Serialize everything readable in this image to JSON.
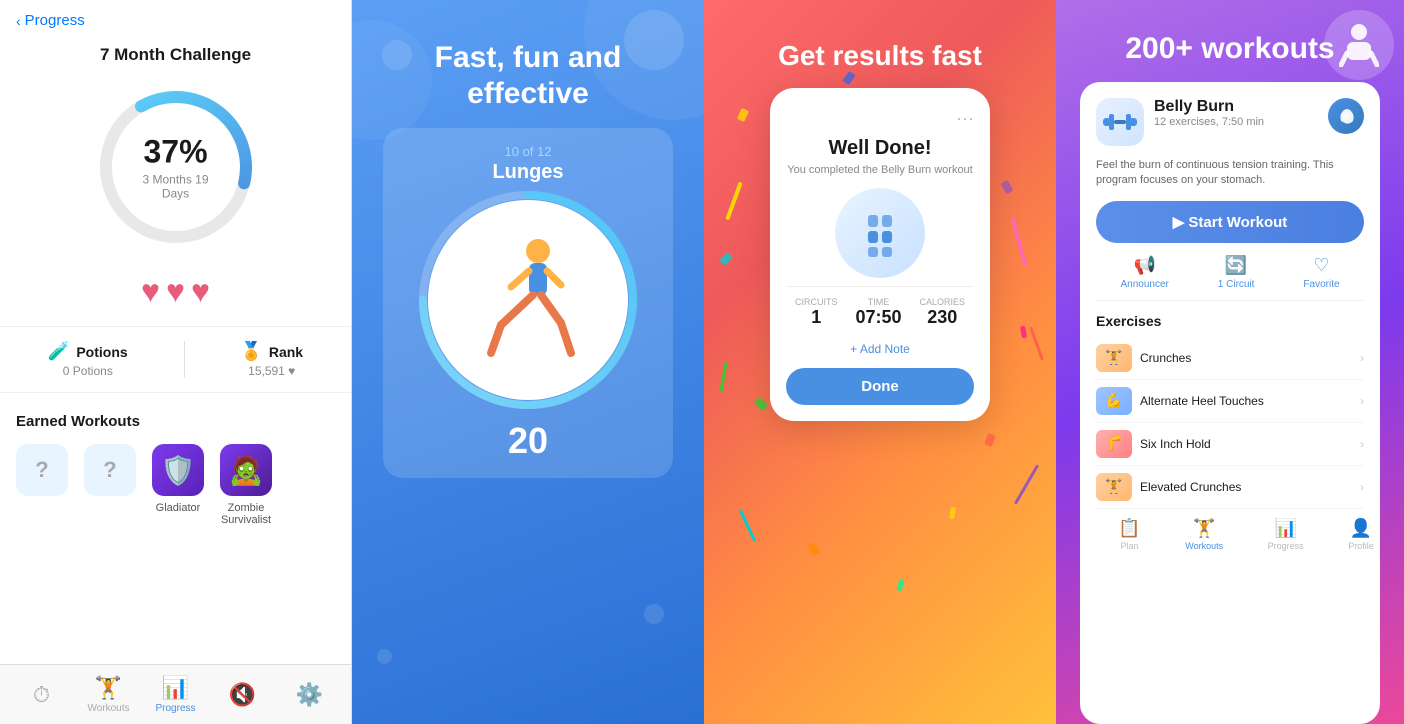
{
  "panel1": {
    "back_label": "Progress",
    "title": "7 Month Challenge",
    "percent": "37%",
    "days_remaining": "3 Months 19 Days",
    "hearts": [
      "❤️",
      "❤️",
      "❤️"
    ],
    "stats": {
      "potions_label": "Potions",
      "potions_value": "0 Potions",
      "rank_label": "Rank",
      "rank_value": "15,591 ♥"
    },
    "earned_title": "Earned Workouts",
    "earned_items": [
      {
        "label": "?",
        "name": "",
        "type": "question"
      },
      {
        "label": "?",
        "name": "",
        "type": "question"
      },
      {
        "label": "🛡️",
        "name": "Gladiator",
        "type": "gladiator"
      },
      {
        "label": "🧟",
        "name": "Zombie\nSurvivalist",
        "type": "zombie"
      }
    ],
    "nav": {
      "items": [
        {
          "icon": "⏱",
          "label": "",
          "active": false
        },
        {
          "icon": "🏋️",
          "label": "Workouts",
          "active": false
        },
        {
          "icon": "📊",
          "label": "Progress",
          "active": true
        },
        {
          "icon": "🔇",
          "label": "",
          "active": false
        },
        {
          "icon": "⚙️",
          "label": "",
          "active": false
        }
      ]
    }
  },
  "panel2": {
    "headline": "Fast, fun and\neffective",
    "exercise_counter": "10 of 12",
    "exercise_name": "Lunges",
    "rep_count": "20"
  },
  "panel3": {
    "headline": "Get results fast",
    "well_done": "Well Done!",
    "subtitle": "You completed the Belly Burn workout",
    "stats": {
      "circuits_label": "Circuits",
      "circuits_value": "1",
      "time_label": "Time",
      "time_value": "07:50",
      "calories_label": "Calories",
      "calories_value": "230"
    },
    "add_note": "+ Add Note",
    "done_button": "Done"
  },
  "panel4": {
    "headline": "200+ workouts",
    "workout": {
      "title": "Belly Burn",
      "subtitle": "12 exercises, 7:50 min",
      "description": "Feel the burn of continuous tension training. This program focuses on your stomach.",
      "start_button": "▶  Start Workout",
      "tabs": [
        {
          "icon": "📢",
          "label": "Announcer"
        },
        {
          "icon": "🔄",
          "label": "1 Circuit"
        },
        {
          "icon": "♡",
          "label": "Favorite"
        }
      ],
      "exercises_title": "Exercises",
      "exercises": [
        {
          "name": "Crunches",
          "type": "orange"
        },
        {
          "name": "Alternate Heel Touches",
          "type": "orange"
        },
        {
          "name": "Six Inch Hold",
          "type": "red"
        },
        {
          "name": "Elevated Crunches",
          "type": "orange"
        }
      ]
    },
    "nav": {
      "items": [
        {
          "icon": "📋",
          "label": "Plan",
          "active": false
        },
        {
          "icon": "🏋️",
          "label": "Workouts",
          "active": true
        },
        {
          "icon": "📊",
          "label": "Progress",
          "active": false
        },
        {
          "icon": "👤",
          "label": "Profile",
          "active": false
        }
      ]
    }
  }
}
